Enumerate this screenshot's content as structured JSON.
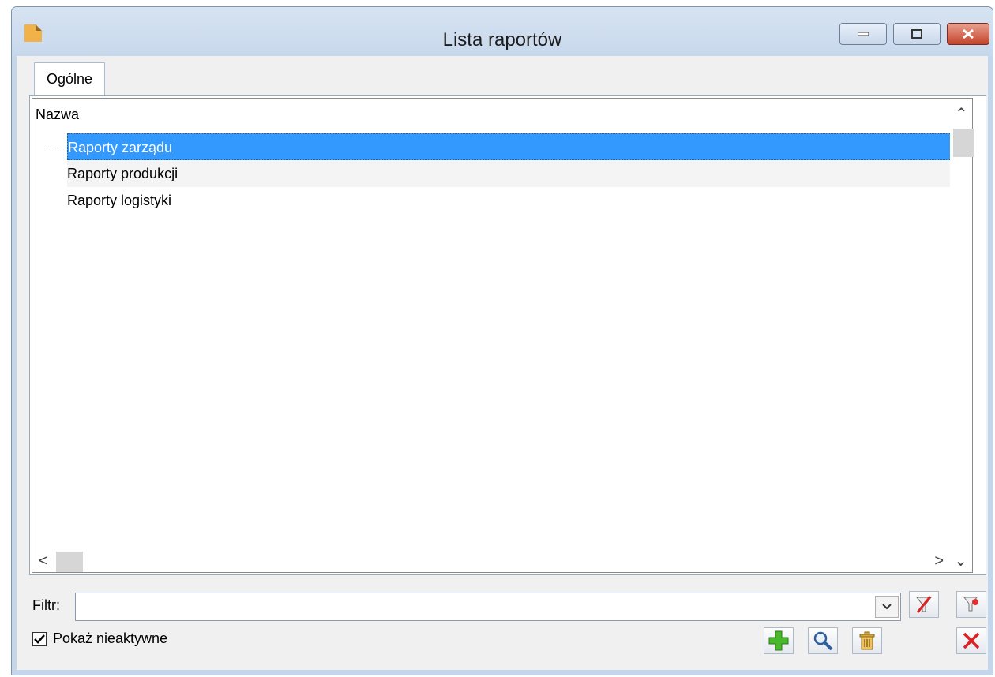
{
  "window": {
    "title": "Lista raportów"
  },
  "tabs": [
    {
      "label": "Ogólne",
      "active": true
    }
  ],
  "list": {
    "column_header": "Nazwa",
    "rows": [
      {
        "label": "Raporty zarządu",
        "selected": true
      },
      {
        "label": "Raporty produkcji",
        "selected": false
      },
      {
        "label": "Raporty logistyki",
        "selected": false
      }
    ]
  },
  "filter": {
    "label": "Filtr:",
    "value": ""
  },
  "show_inactive": {
    "label": "Pokaż nieaktywne",
    "checked": true
  },
  "colors": {
    "selection": "#3399ff",
    "titlebar": "#c8d8ec",
    "close_button": "#c4432b"
  }
}
